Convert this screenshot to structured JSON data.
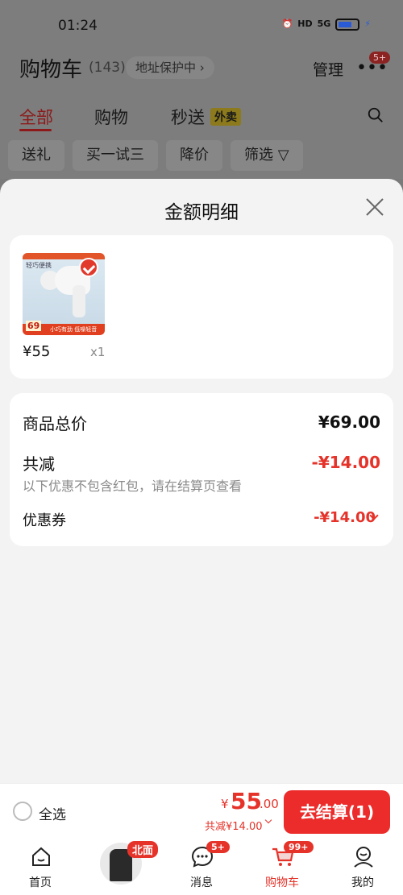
{
  "status_bar": {
    "time": "01:24",
    "signal_label": "HD",
    "net_label": "5G"
  },
  "cart_header": {
    "title": "购物车",
    "count": "(143)",
    "address_pill": "地址保护中 ›",
    "manage_label": "管理",
    "more_badge": "5+"
  },
  "tabs": [
    {
      "label": "全部",
      "active": true
    },
    {
      "label": "购物",
      "active": false
    },
    {
      "label": "秒送",
      "active": false
    }
  ],
  "tab_tag": "外卖",
  "filter_chips": [
    "送礼",
    "买一试三",
    "降价",
    "筛选 ▽"
  ],
  "sheet": {
    "title": "金额明细",
    "product": {
      "price": "¥55",
      "qty": "x1",
      "image_price": "69",
      "image_label_top": "轻巧便携",
      "image_label_bottom": "小巧有劲 低噪轻音"
    },
    "detail": {
      "total_label": "商品总价",
      "total_value": "¥69.00",
      "reduced_label": "共减",
      "reduced_value": "-¥14.00",
      "reduced_note": "以下优惠不包含红包，请在结算页查看",
      "coupon_label": "优惠券",
      "coupon_value": "-¥14.00"
    }
  },
  "checkout": {
    "select_all": "全选",
    "yuan_symbol": "¥",
    "total_int": "55",
    "total_dec": ".00",
    "reduced": "共减¥14.00",
    "button": "去结算(1)"
  },
  "tabbar": {
    "items": [
      {
        "label": "首页",
        "icon": "home-icon"
      },
      {
        "label": "",
        "icon": "avatar"
      },
      {
        "label": "消息",
        "icon": "message-icon",
        "badge": "5+"
      },
      {
        "label": "购物车",
        "icon": "cart-icon",
        "badge": "99+",
        "active": true
      },
      {
        "label": "我的",
        "icon": "profile-icon"
      }
    ],
    "avatar_badge": "北面"
  },
  "colors": {
    "accent": "#e5332a",
    "sheet_bg": "#f3f3f3",
    "dim_bg": "#7d7d7d"
  }
}
